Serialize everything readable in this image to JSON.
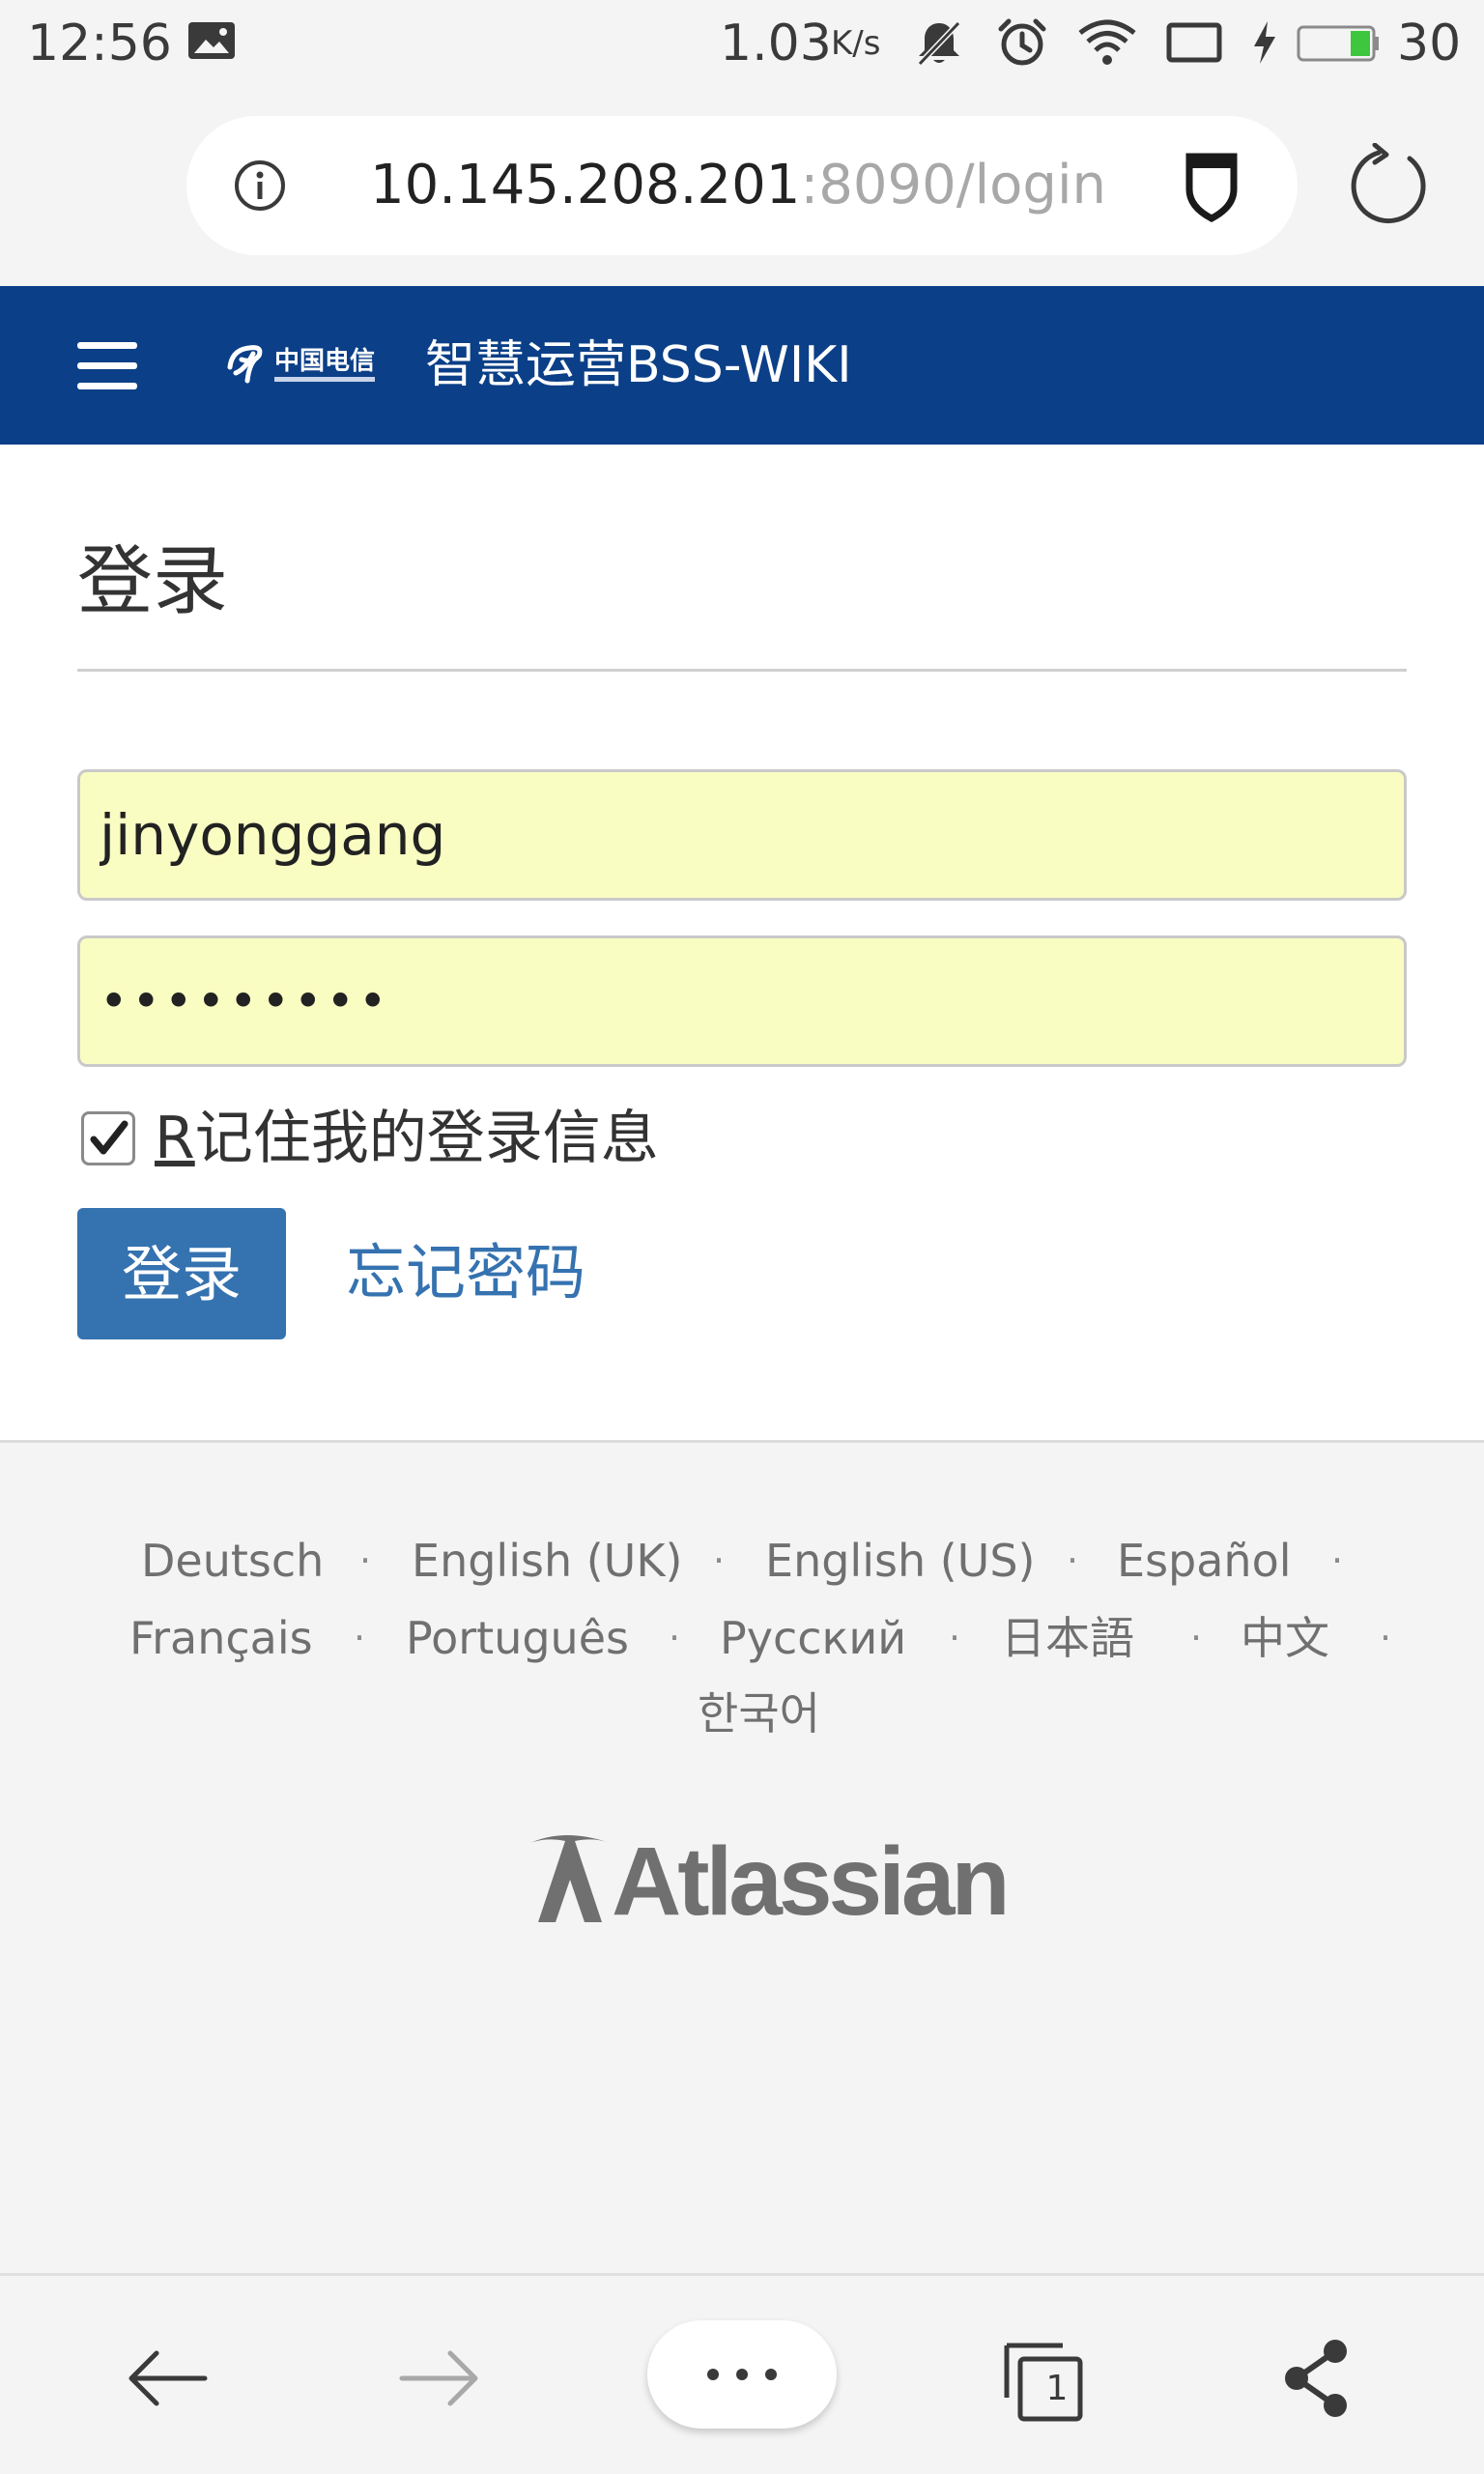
{
  "status_bar": {
    "time": "12:56",
    "speed": "1.03",
    "speed_unit": "K/s",
    "battery_percent": "30"
  },
  "browser": {
    "url_host": "10.145.208.201",
    "url_path": ":8090/login"
  },
  "header": {
    "site_title": "智慧运营BSS-WIKI",
    "logo_text": "中国电信"
  },
  "login": {
    "title": "登录",
    "username_value": "jinyonggang",
    "password_value": "•••••••••",
    "remember_checked": true,
    "remember_accel": "R",
    "remember_label": "记住我的登录信息",
    "login_button": "登录",
    "forgot_link": "忘记密码"
  },
  "footer": {
    "languages": [
      "Deutsch",
      "English (UK)",
      "English (US)",
      "Español",
      "Français",
      "Português",
      "Русский",
      "日本語",
      "中文",
      "한국어"
    ],
    "separator": "·",
    "brand": "Atlassian"
  },
  "bottom_nav": {
    "tab_count": "1"
  },
  "colors": {
    "header_bg": "#0b3f87",
    "button_bg": "#3572b0",
    "link": "#3572b0",
    "autofill_bg": "#fafdc2",
    "battery_green": "#3fc63f"
  }
}
